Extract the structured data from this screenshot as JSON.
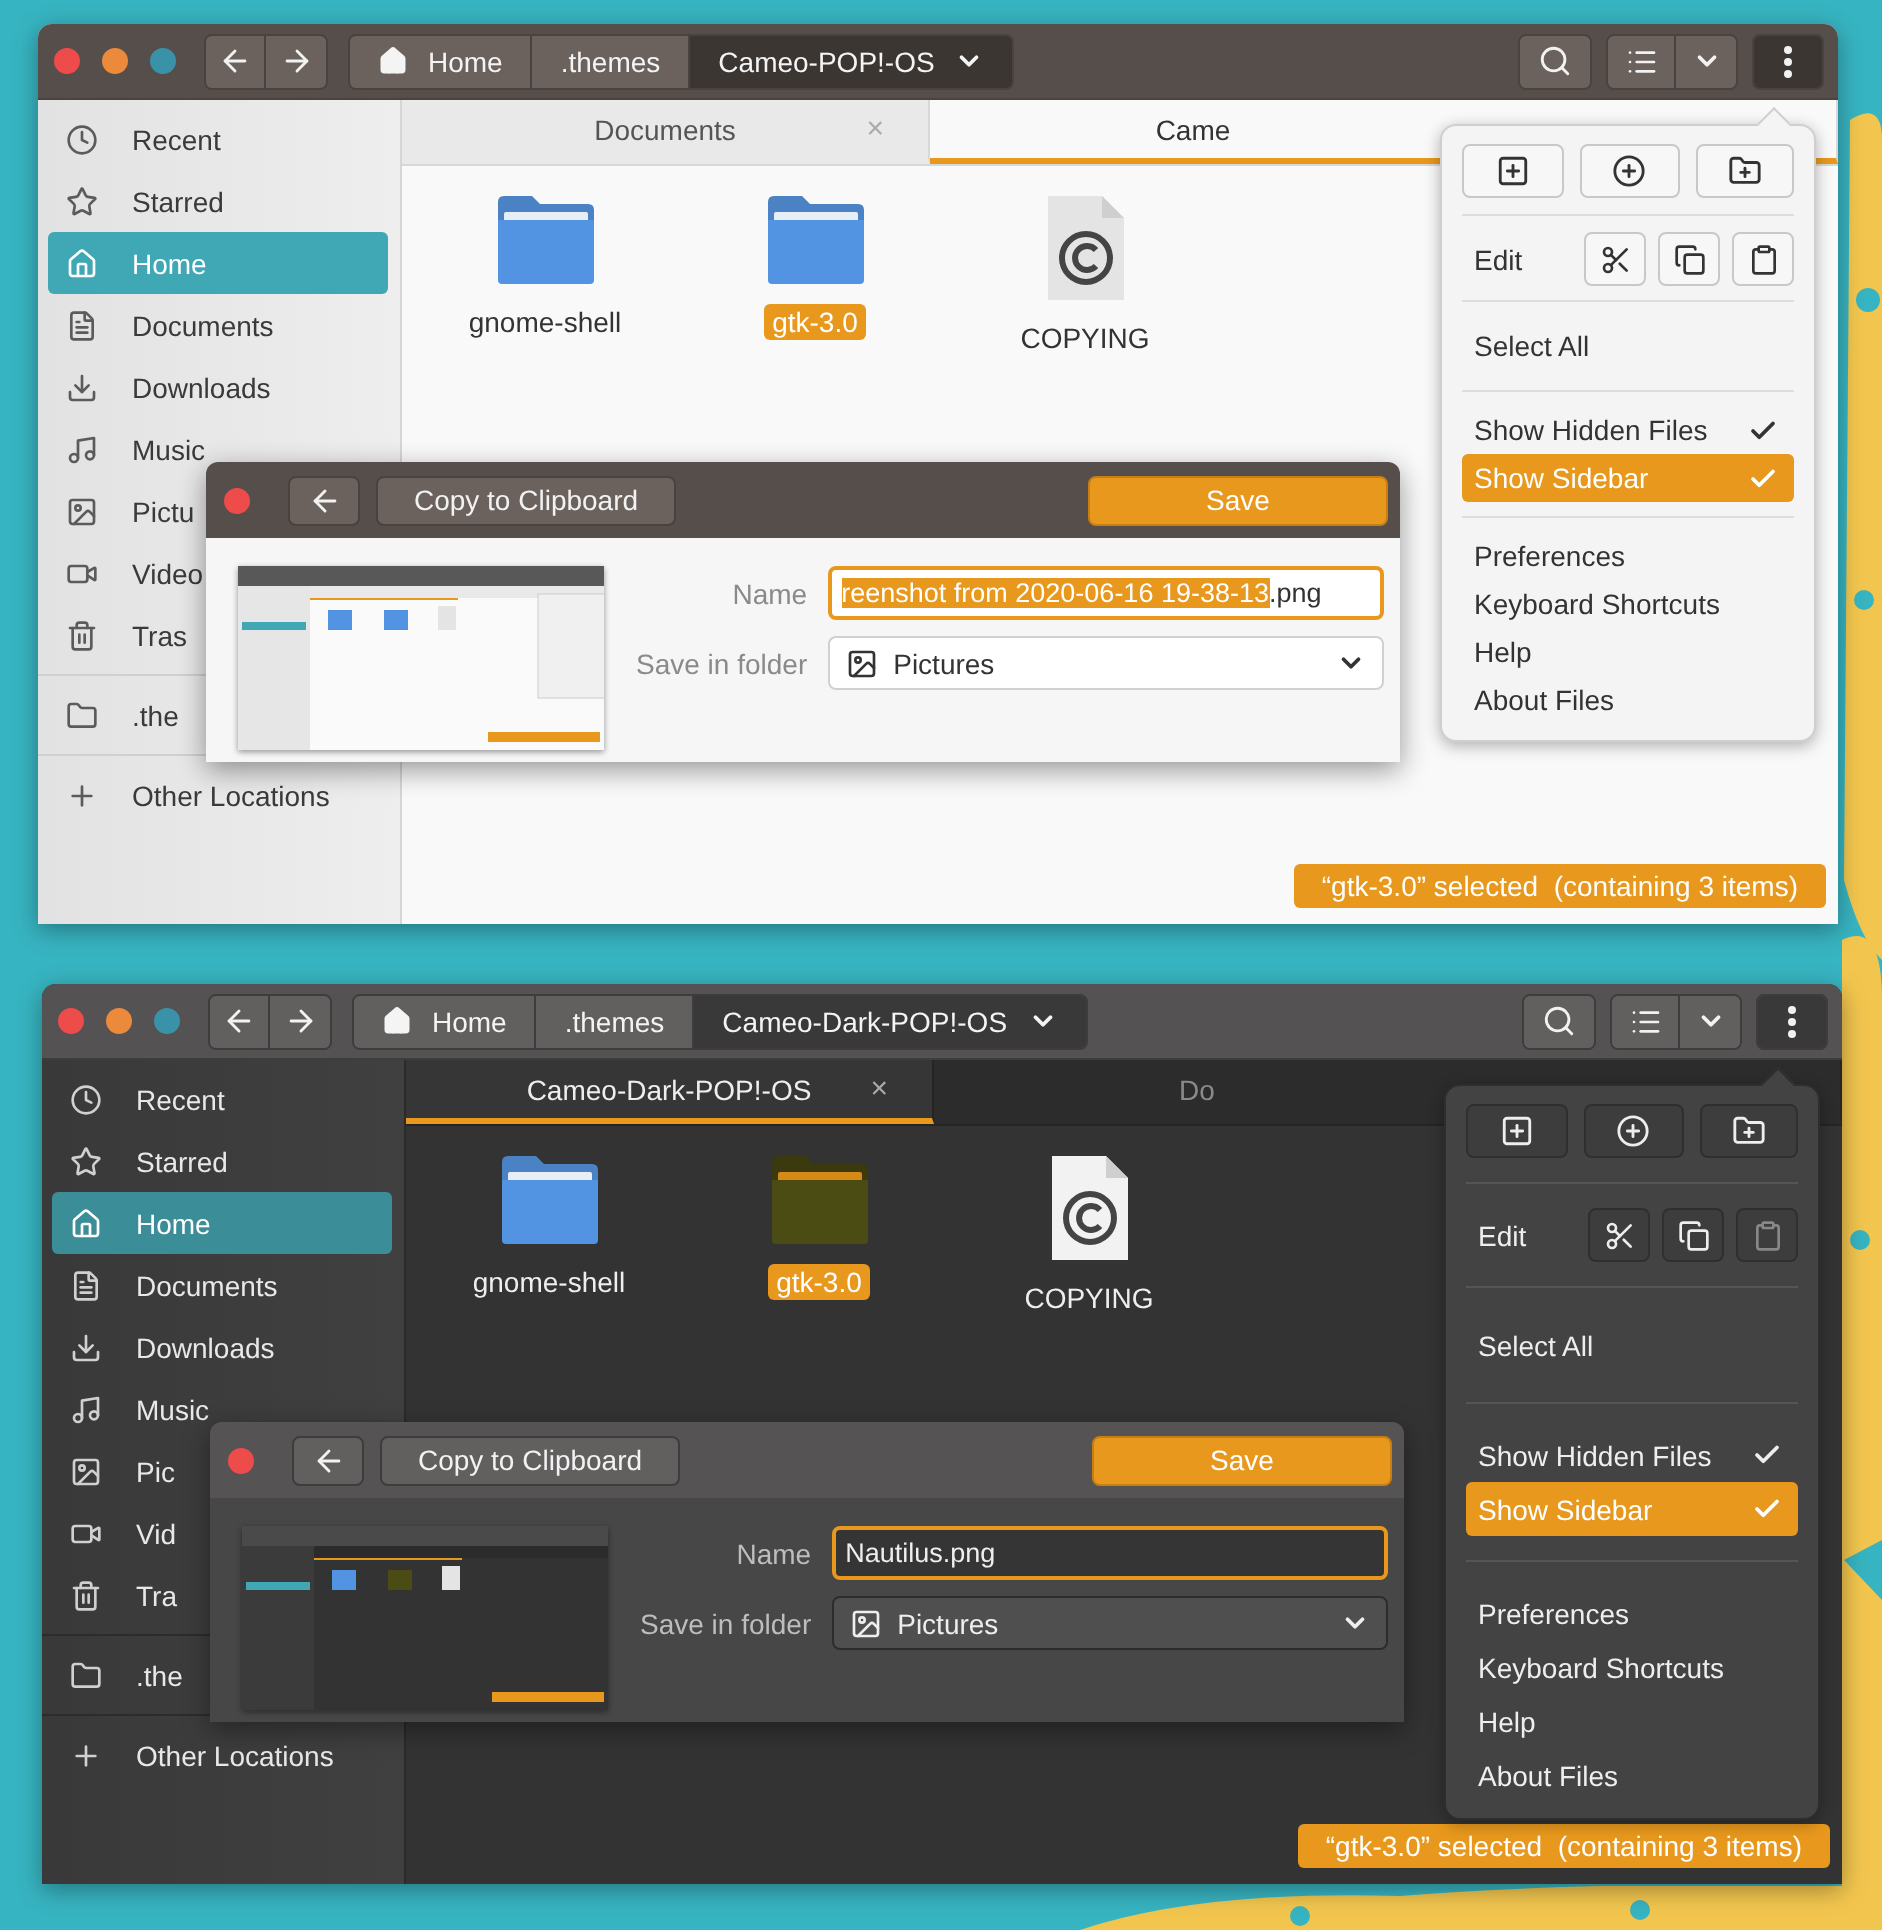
{
  "windows": [
    {
      "kind": "light",
      "path": [
        {
          "kind": "home",
          "label": "Home",
          "selected": false
        },
        {
          "kind": "folder",
          "label": ".themes",
          "selected": false
        },
        {
          "kind": "folder",
          "label": "Cameo-POP!-OS",
          "selected": true
        }
      ],
      "sidebar": {
        "groups": [
          [
            {
              "kind": "recent",
              "label": "Recent",
              "selected": false
            },
            {
              "kind": "starred",
              "label": "Starred",
              "selected": false
            },
            {
              "kind": "home",
              "label": "Home",
              "selected": true
            },
            {
              "kind": "documents",
              "label": "Documents",
              "selected": false
            },
            {
              "kind": "downloads",
              "label": "Downloads",
              "selected": false
            },
            {
              "kind": "music",
              "label": "Music",
              "selected": false
            },
            {
              "kind": "pictures",
              "label": "Pictu",
              "selected": false
            },
            {
              "kind": "videos",
              "label": "Video",
              "selected": false
            },
            {
              "kind": "trash",
              "label": "Tras",
              "selected": false
            }
          ],
          [
            {
              "kind": "folder",
              "label": ".the",
              "selected": false
            }
          ],
          [
            {
              "kind": "other",
              "label": "Other Locations",
              "selected": false
            }
          ]
        ]
      },
      "tabs": [
        {
          "label": "Documents",
          "selected": false,
          "close": "×"
        },
        {
          "label": "Came",
          "selected": true
        }
      ],
      "files": [
        {
          "kind": "folder",
          "name": "gnome-shell",
          "selected": false
        },
        {
          "kind": "folder",
          "name": "gtk-3.0",
          "selected": true
        },
        {
          "kind": "document",
          "name": "COPYING",
          "selected": false
        }
      ],
      "status": "“gtk-3.0” selected  (containing 3 items)",
      "menu": {
        "edit": {
          "label": "Edit",
          "actions": [
            {
              "kind": "cut",
              "disabled": false
            },
            {
              "kind": "copy",
              "disabled": false
            },
            {
              "kind": "paste",
              "disabled": false
            }
          ]
        },
        "sections": [
          [
            {
              "label": "Select All",
              "selected": false
            }
          ],
          [
            {
              "label": "Show Hidden Files",
              "selected": false,
              "checked": true
            },
            {
              "label": "Show Sidebar",
              "selected": true,
              "checked": true
            }
          ],
          [
            {
              "label": "Preferences",
              "selected": false
            },
            {
              "label": "Keyboard Shortcuts",
              "selected": false
            },
            {
              "label": "Help",
              "selected": false
            },
            {
              "label": "About Files",
              "selected": false
            }
          ]
        ]
      },
      "dialog": {
        "clipboard": "Copy to Clipboard",
        "save": "Save",
        "name_label": "Name",
        "name_parts": [
          {
            "text": "reenshot from 2020-06-16 19-38-13",
            "selected": true
          },
          {
            "text": ".png",
            "selected": false
          }
        ],
        "folder_label": "Save in folder",
        "folder": "Pictures"
      }
    },
    {
      "kind": "dark",
      "path": [
        {
          "kind": "home",
          "label": "Home",
          "selected": false
        },
        {
          "kind": "folder",
          "label": ".themes",
          "selected": false
        },
        {
          "kind": "folder",
          "label": "Cameo-Dark-POP!-OS",
          "selected": true
        }
      ],
      "sidebar": {
        "groups": [
          [
            {
              "kind": "recent",
              "label": "Recent",
              "selected": false
            },
            {
              "kind": "starred",
              "label": "Starred",
              "selected": false
            },
            {
              "kind": "home",
              "label": "Home",
              "selected": true
            },
            {
              "kind": "documents",
              "label": "Documents",
              "selected": false
            },
            {
              "kind": "downloads",
              "label": "Downloads",
              "selected": false
            },
            {
              "kind": "music",
              "label": "Music",
              "selected": false
            },
            {
              "kind": "pictures",
              "label": "Pic",
              "selected": false
            },
            {
              "kind": "videos",
              "label": "Vid",
              "selected": false
            },
            {
              "kind": "trash",
              "label": "Tra",
              "selected": false
            }
          ],
          [
            {
              "kind": "folder",
              "label": ".the",
              "selected": false
            }
          ],
          [
            {
              "kind": "other",
              "label": "Other Locations",
              "selected": false
            }
          ]
        ]
      },
      "tabs": [
        {
          "label": "Cameo-Dark-POP!-OS",
          "selected": true,
          "close": "×"
        },
        {
          "label": "Do",
          "selected": false
        }
      ],
      "files": [
        {
          "kind": "folder",
          "name": "gnome-shell",
          "selected": false
        },
        {
          "kind": "folder",
          "name": "gtk-3.0",
          "selected": true
        },
        {
          "kind": "document",
          "name": "COPYING",
          "selected": false
        }
      ],
      "status": "“gtk-3.0” selected  (containing 3 items)",
      "menu": {
        "edit": {
          "label": "Edit",
          "actions": [
            {
              "kind": "cut",
              "disabled": false
            },
            {
              "kind": "copy",
              "disabled": false
            },
            {
              "kind": "paste",
              "disabled": true
            }
          ]
        },
        "sections": [
          [
            {
              "label": "Select All",
              "selected": false
            }
          ],
          [
            {
              "label": "Show Hidden Files",
              "selected": false,
              "checked": true
            },
            {
              "label": "Show Sidebar",
              "selected": true,
              "checked": true
            }
          ],
          [
            {
              "label": "Preferences",
              "selected": false
            },
            {
              "label": "Keyboard Shortcuts",
              "selected": false
            },
            {
              "label": "Help",
              "selected": false
            },
            {
              "label": "About Files",
              "selected": false
            }
          ]
        ]
      },
      "dialog": {
        "clipboard": "Copy to Clipboard",
        "save": "Save",
        "name_label": "Name",
        "name_parts": [
          {
            "text": "Nautilus.png",
            "selected": false
          }
        ],
        "folder_label": "Save in folder",
        "folder": "Pictures"
      }
    }
  ]
}
